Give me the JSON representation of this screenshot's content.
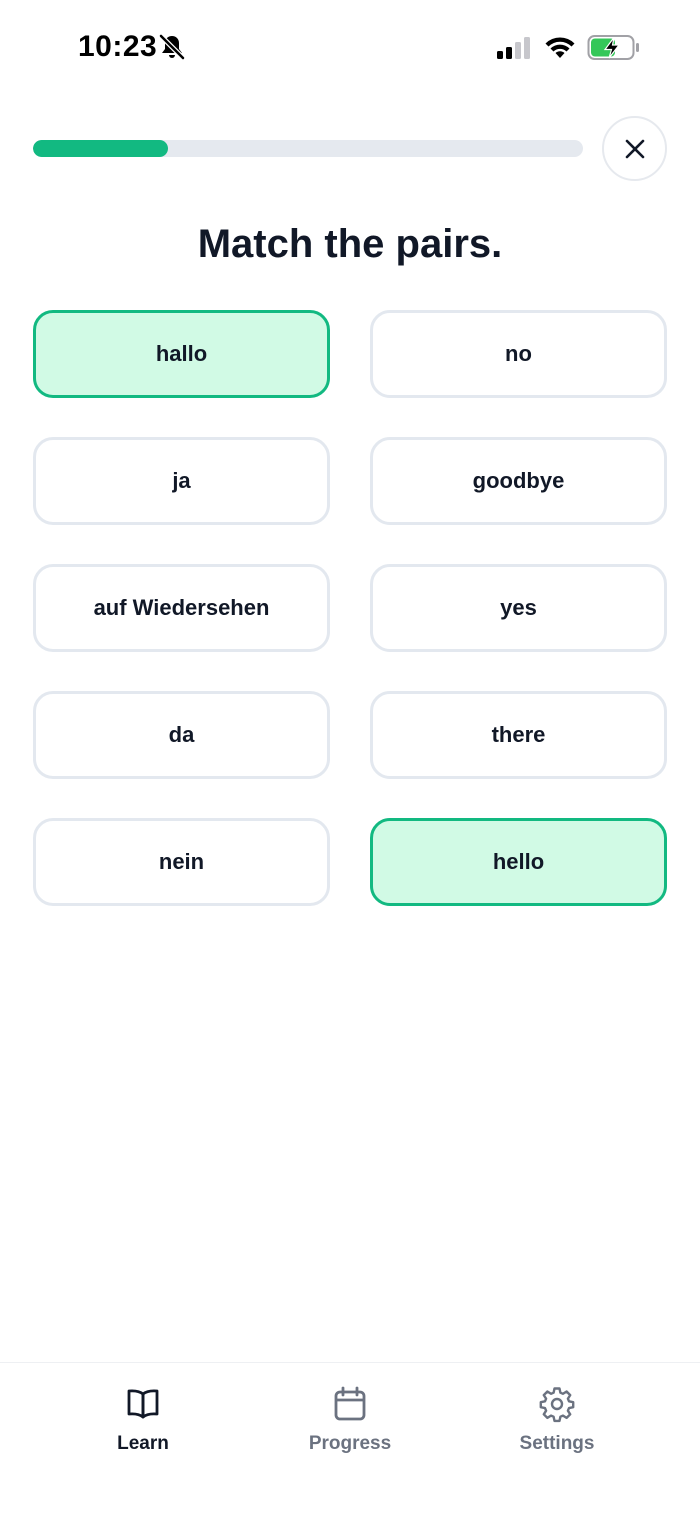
{
  "status_bar": {
    "time": "10:23",
    "icons": [
      "bell-slash-icon",
      "signal-icon",
      "wifi-icon",
      "battery-charging-icon"
    ],
    "battery_color": "#34c759"
  },
  "lesson": {
    "progress_percent": 24.5,
    "progress_color": "#12b981",
    "title": "Match the pairs."
  },
  "tiles": [
    {
      "label": "hallo",
      "selected": true
    },
    {
      "label": "no",
      "selected": false
    },
    {
      "label": "ja",
      "selected": false
    },
    {
      "label": "goodbye",
      "selected": false
    },
    {
      "label": "auf Wiedersehen",
      "selected": false
    },
    {
      "label": "yes",
      "selected": false
    },
    {
      "label": "da",
      "selected": false
    },
    {
      "label": "there",
      "selected": false
    },
    {
      "label": "nein",
      "selected": false
    },
    {
      "label": "hello",
      "selected": true
    }
  ],
  "colors": {
    "selected_border": "#12b981",
    "selected_fill": "#d1fae5",
    "tile_border": "#e3e8ef"
  },
  "nav": {
    "items": [
      {
        "label": "Learn",
        "icon": "book-icon",
        "active": true
      },
      {
        "label": "Progress",
        "icon": "calendar-icon",
        "active": false
      },
      {
        "label": "Settings",
        "icon": "gear-icon",
        "active": false
      }
    ]
  }
}
